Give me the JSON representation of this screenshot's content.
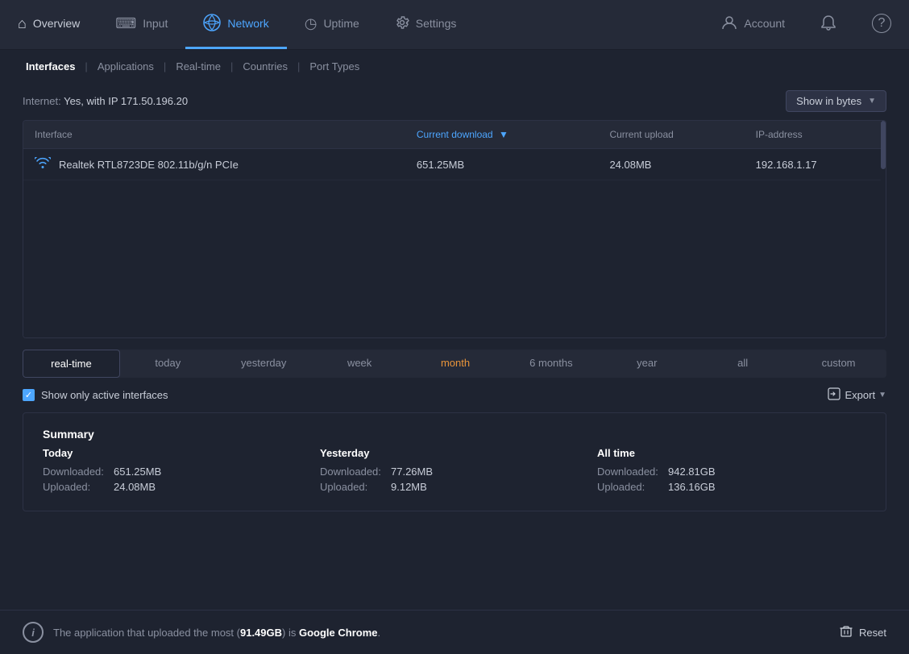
{
  "nav": {
    "items": [
      {
        "id": "overview",
        "label": "Overview",
        "icon": "⌂",
        "active": false
      },
      {
        "id": "input",
        "label": "Input",
        "icon": "⌨",
        "active": false
      },
      {
        "id": "network",
        "label": "Network",
        "icon": "⇄",
        "active": true
      },
      {
        "id": "uptime",
        "label": "Uptime",
        "icon": "◷",
        "active": false
      },
      {
        "id": "settings",
        "label": "Settings",
        "icon": "⚙",
        "active": false
      },
      {
        "id": "account",
        "label": "Account",
        "icon": "👤",
        "active": false
      }
    ],
    "help_icon": "?",
    "notification_icon": "📢"
  },
  "subnav": {
    "items": [
      {
        "id": "interfaces",
        "label": "Interfaces",
        "active": true
      },
      {
        "id": "applications",
        "label": "Applications",
        "active": false
      },
      {
        "id": "realtime",
        "label": "Real-time",
        "active": false
      },
      {
        "id": "countries",
        "label": "Countries",
        "active": false
      },
      {
        "id": "porttypes",
        "label": "Port Types",
        "active": false
      }
    ]
  },
  "internet": {
    "label": "Internet:",
    "value": "Yes, with IP 171.50.196.20"
  },
  "show_bytes_btn": "Show in bytes",
  "table": {
    "columns": [
      {
        "id": "interface",
        "label": "Interface",
        "sortable": false
      },
      {
        "id": "download",
        "label": "Current download",
        "sortable": true,
        "sorted": true
      },
      {
        "id": "upload",
        "label": "Current upload",
        "sortable": false
      },
      {
        "id": "ip",
        "label": "IP-address",
        "sortable": false
      }
    ],
    "rows": [
      {
        "interface": "Realtek RTL8723DE 802.11b/g/n PCIe",
        "download": "651.25MB",
        "upload": "24.08MB",
        "ip": "192.168.1.17",
        "has_wifi": true
      }
    ]
  },
  "time_tabs": [
    {
      "id": "realtime",
      "label": "real-time",
      "active": true
    },
    {
      "id": "today",
      "label": "today",
      "active": false
    },
    {
      "id": "yesterday",
      "label": "yesterday",
      "active": false
    },
    {
      "id": "week",
      "label": "week",
      "active": false
    },
    {
      "id": "month",
      "label": "month",
      "active": false,
      "highlight": true
    },
    {
      "id": "6months",
      "label": "6 months",
      "active": false
    },
    {
      "id": "year",
      "label": "year",
      "active": false
    },
    {
      "id": "all",
      "label": "all",
      "active": false
    },
    {
      "id": "custom",
      "label": "custom",
      "active": false
    }
  ],
  "active_interfaces": {
    "label": "Show only active interfaces",
    "checked": true
  },
  "export_label": "Export",
  "summary": {
    "title": "Summary",
    "today": {
      "title": "Today",
      "downloaded_label": "Downloaded:",
      "downloaded_value": "651.25MB",
      "uploaded_label": "Uploaded:",
      "uploaded_value": "24.08MB"
    },
    "yesterday": {
      "title": "Yesterday",
      "downloaded_label": "Downloaded:",
      "downloaded_value": "77.26MB",
      "uploaded_label": "Uploaded:",
      "uploaded_value": "9.12MB"
    },
    "alltime": {
      "title": "All time",
      "downloaded_label": "Downloaded:",
      "downloaded_value": "942.81GB",
      "uploaded_label": "Uploaded:",
      "uploaded_value": "136.16GB"
    }
  },
  "bottom_bar": {
    "info_text_before": "The application that uploaded the most (",
    "info_highlight": "91.49GB",
    "info_text_after": ") is ",
    "info_app": "Google Chrome",
    "reset_label": "Reset"
  }
}
